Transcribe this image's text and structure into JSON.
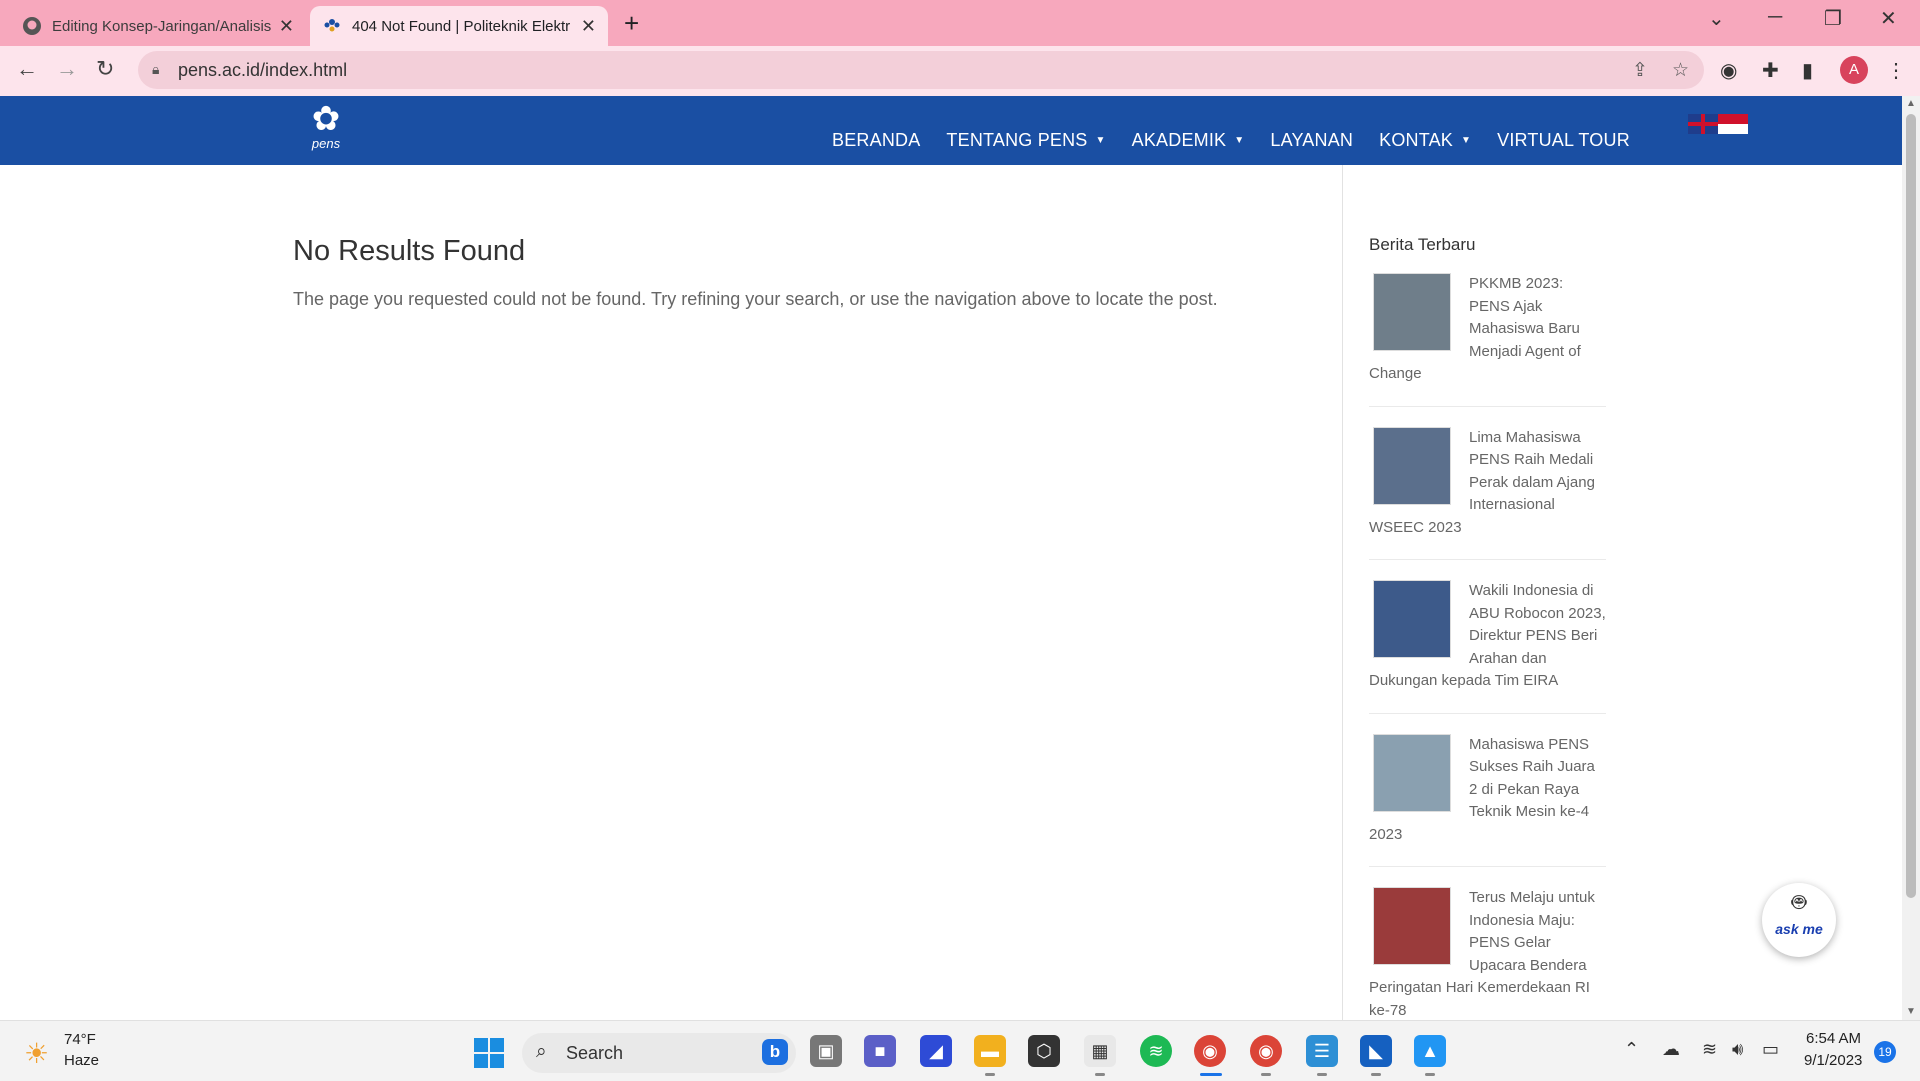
{
  "browser": {
    "tabs": [
      {
        "title": "Editing Konsep-Jaringan/Analisis",
        "favicon": "github-icon"
      },
      {
        "title": "404 Not Found | Politeknik Elektr",
        "favicon": "pens-icon"
      }
    ],
    "new_tab_label": "+",
    "url": "pens.ac.id/index.html",
    "profile_initial": "A"
  },
  "site": {
    "logo_text": "pens",
    "nav": [
      {
        "label": "BERANDA",
        "has_dropdown": false
      },
      {
        "label": "TENTANG PENS",
        "has_dropdown": true
      },
      {
        "label": "AKADEMIK",
        "has_dropdown": true
      },
      {
        "label": "LAYANAN",
        "has_dropdown": false
      },
      {
        "label": "KONTAK",
        "has_dropdown": true
      },
      {
        "label": "VIRTUAL TOUR",
        "has_dropdown": false
      }
    ],
    "colors": {
      "header_bg": "#1a4fa3",
      "tab_strip": "#f7a8bd"
    }
  },
  "main": {
    "heading": "No Results Found",
    "message": "The page you requested could not be found. Try refining your search, or use the navigation above to locate the post."
  },
  "sidebar": {
    "title": "Berita Terbaru",
    "items": [
      {
        "title": "PKKMB 2023: PENS Ajak Mahasiswa Baru Menjadi Agent of Change",
        "thumb_color": "#6f7e8a"
      },
      {
        "title": "Lima Mahasiswa PENS Raih Medali Perak dalam Ajang Internasional WSEEC 2023",
        "thumb_color": "#5b6f8c"
      },
      {
        "title": "Wakili Indonesia di ABU Robocon 2023, Direktur PENS Beri Arahan dan Dukungan kepada Tim EIRA",
        "thumb_color": "#3d5a8a"
      },
      {
        "title": "Mahasiswa PENS Sukses Raih Juara 2 di Pekan Raya Teknik Mesin ke-4 2023",
        "thumb_color": "#8aa0b0"
      },
      {
        "title": "Terus Melaju untuk Indonesia Maju: PENS Gelar Upacara Bendera Peringatan Hari Kemerdekaan RI ke-78",
        "thumb_color": "#9a3b3b"
      }
    ]
  },
  "chatbot": {
    "label": "ask me"
  },
  "taskbar": {
    "weather_temp": "74°F",
    "weather_cond": "Haze",
    "search_label": "Search",
    "time": "6:54 AM",
    "date": "9/1/2023",
    "notification_count": "19"
  }
}
